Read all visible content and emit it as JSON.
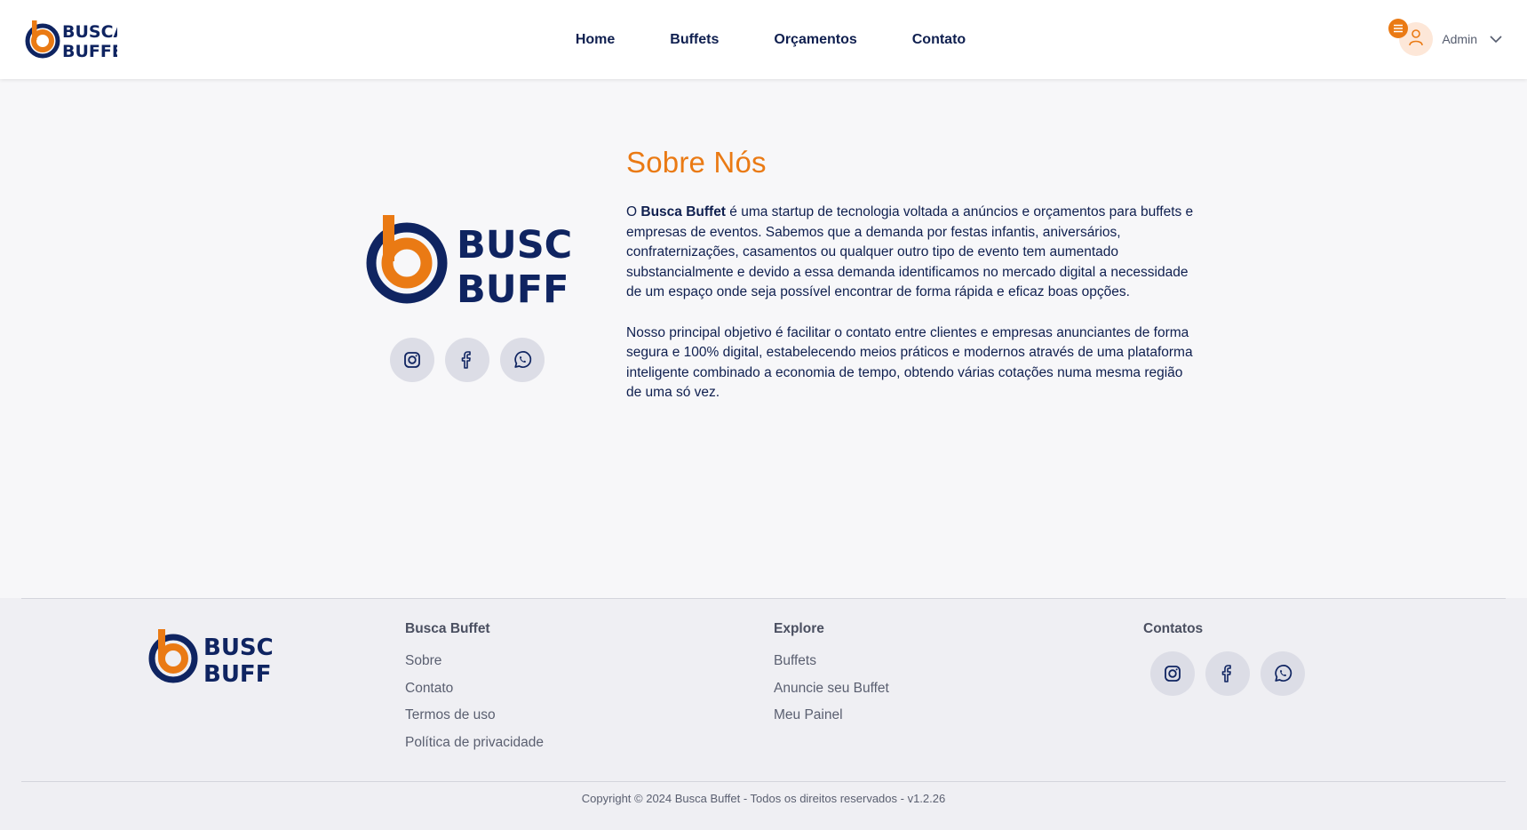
{
  "brand": {
    "line1": "BUSCA",
    "line2": "BUFFET",
    "colors": {
      "orange": "#ea7a14",
      "navy": "#0f2461"
    }
  },
  "nav": {
    "items": [
      {
        "label": "Home"
      },
      {
        "label": "Buffets"
      },
      {
        "label": "Orçamentos"
      },
      {
        "label": "Contato"
      }
    ]
  },
  "user": {
    "name": "Admin",
    "avatar_icon": "user-icon",
    "badge_icon": "menu-icon"
  },
  "about": {
    "title": "Sobre Nós",
    "p1_prefix": "O ",
    "p1_brand": "Busca Buffet",
    "p1_rest": " é uma startup de tecnologia voltada a anúncios e orçamentos para buffets e empresas de eventos. Sabemos que a demanda por festas infantis, aniversários, confraternizações, casamentos ou qualquer outro tipo de evento tem aumentado substancialmente e devido a essa demanda identificamos no mercado digital a necessidade de um espaço onde seja possível encontrar de forma rápida e eficaz boas opções.",
    "p2": "Nosso principal objetivo é facilitar o contato entre clientes e empresas anunciantes de forma segura e 100% digital, estabelecendo meios práticos e modernos através de uma plataforma inteligente combinado a economia de tempo, obtendo várias cotações numa mesma região de uma só vez.",
    "social_icons": [
      "instagram-icon",
      "facebook-icon",
      "whatsapp-icon"
    ]
  },
  "footer": {
    "col1": {
      "heading": "Busca Buffet",
      "links": [
        "Sobre",
        "Contato",
        "Termos de uso",
        "Política de privacidade"
      ]
    },
    "col2": {
      "heading": "Explore",
      "links": [
        "Buffets",
        "Anuncie seu Buffet",
        "Meu Painel"
      ]
    },
    "col3": {
      "heading": "Contatos",
      "social_icons": [
        "instagram-icon",
        "facebook-icon",
        "whatsapp-icon"
      ]
    },
    "copyright": "Copyright © 2024 Busca Buffet - Todos os direitos reservados - v1.2.26"
  }
}
